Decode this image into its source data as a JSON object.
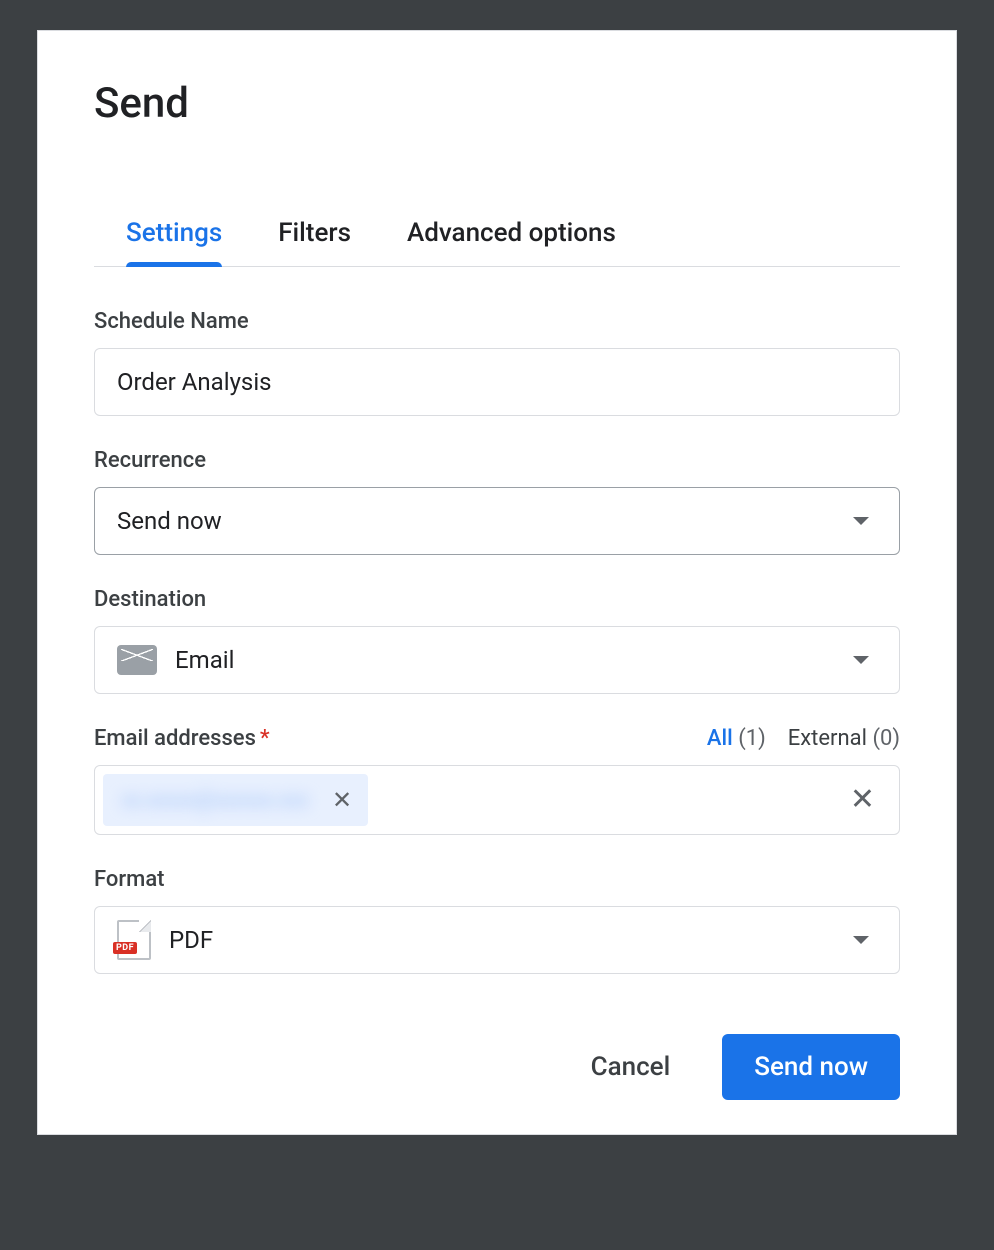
{
  "dialog": {
    "title": "Send"
  },
  "tabs": {
    "settings": "Settings",
    "filters": "Filters",
    "advanced": "Advanced options"
  },
  "fields": {
    "scheduleName": {
      "label": "Schedule Name",
      "value": "Order Analysis"
    },
    "recurrence": {
      "label": "Recurrence",
      "value": "Send now"
    },
    "destination": {
      "label": "Destination",
      "value": "Email"
    },
    "emails": {
      "label": "Email addresses",
      "required": "*",
      "allLabel": "All",
      "allCount": "(1)",
      "externalLabel": "External",
      "externalCount": "(0)",
      "chip": "xx.xxxxx@xxxxxx.xxx"
    },
    "format": {
      "label": "Format",
      "value": "PDF",
      "badge": "PDF"
    }
  },
  "actions": {
    "cancel": "Cancel",
    "send": "Send now"
  }
}
